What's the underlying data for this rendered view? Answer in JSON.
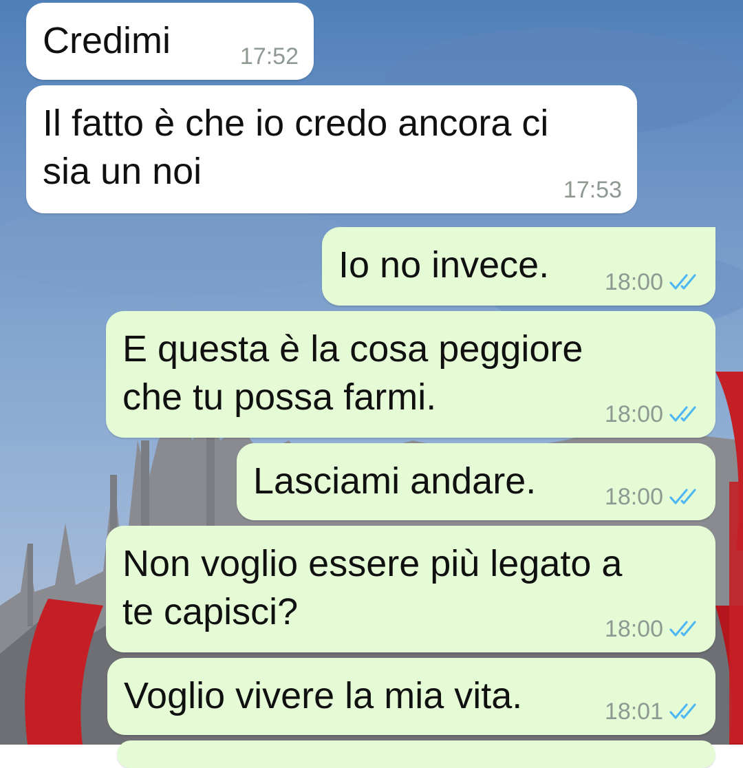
{
  "colors": {
    "incoming_bubble": "#ffffff",
    "outgoing_bubble": "#e5fbd6",
    "timestamp": "#8e9a91",
    "read_ticks": "#4fb7f2",
    "wallpaper_sky": "#6f95c6"
  },
  "messages": [
    {
      "direction": "in",
      "text": "Credimi",
      "time": "17:52"
    },
    {
      "direction": "in",
      "text": "Il fatto è che io credo ancora ci\nsia un noi",
      "time": "17:53"
    },
    {
      "direction": "out",
      "text": "Io no invece.",
      "time": "18:00",
      "status_icon": "double-check-read"
    },
    {
      "direction": "out",
      "text": "E questa è la cosa peggiore\nche tu possa farmi.",
      "time": "18:00",
      "status_icon": "double-check-read"
    },
    {
      "direction": "out",
      "text": "Lasciami andare.",
      "time": "18:00",
      "status_icon": "double-check-read"
    },
    {
      "direction": "out",
      "text": "Non voglio essere più legato a\nte capisci?",
      "time": "18:00",
      "status_icon": "double-check-read"
    },
    {
      "direction": "out",
      "text": "Voglio vivere la mia vita.",
      "time": "18:01",
      "status_icon": "double-check-read"
    }
  ]
}
